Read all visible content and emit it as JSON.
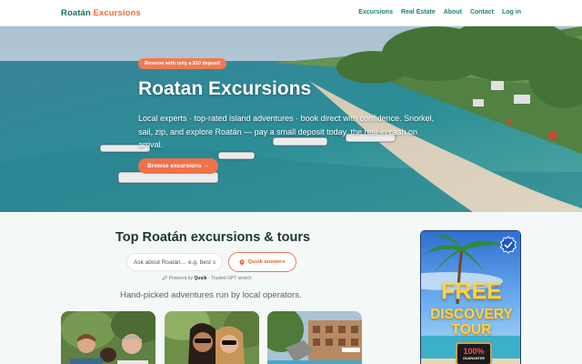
{
  "header": {
    "logo_part1": "Roatán",
    "logo_part2": "Excursions",
    "nav": [
      "Excursions",
      "Real Estate",
      "About",
      "Contact",
      "Log in"
    ]
  },
  "hero": {
    "badge": "Reserve with only a $10 deposit",
    "title": "Roatan Excursions",
    "subtitle": "Local experts · top-rated island adventures · book direct with confidence. Snorkel, sail, zip, and explore Roatán — pay a small deposit today, the rest in cash on arrival.",
    "cta": "Browse excursions →"
  },
  "main": {
    "title": "Top Roatán excursions & tours",
    "search_placeholder": "Ask about Roatán… e.g. best snorkel",
    "quik_button": "Quuik answers",
    "powered_prefix": "Powered by",
    "powered_brand": "Quuik",
    "powered_suffix": "· Trusted GPT search",
    "lead": "Hand-picked adventures run by local operators."
  },
  "ad": {
    "line1": "FREE",
    "line2": "DISCOVERY",
    "line3": "TOUR",
    "badge_pct": "100%",
    "badge_text": "GUARANTEE"
  },
  "colors": {
    "brand_teal": "#1f6a63",
    "accent_orange": "#ef6a3a",
    "ad_yellow": "#f7d44a"
  }
}
